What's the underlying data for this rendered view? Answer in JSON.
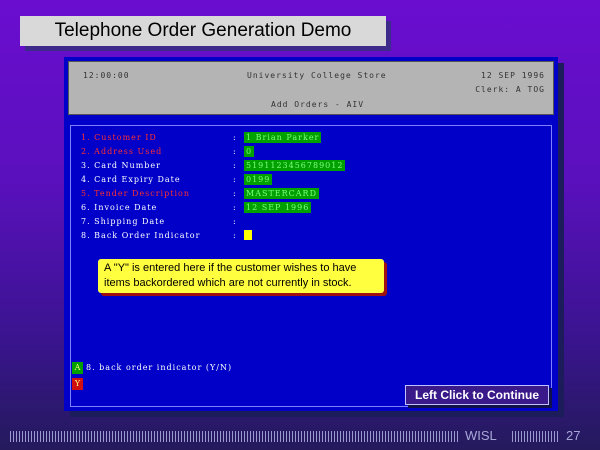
{
  "title": "Telephone Order Generation Demo",
  "header": {
    "time": "12:00:00",
    "store": "University College Store",
    "date": "12 SEP 1996",
    "clerk": "Clerk: A TOG",
    "mode": "Add Orders - AIV"
  },
  "fields": [
    {
      "label": "1. Customer ID",
      "value": "1 Brian Parker",
      "color": "#ff3030"
    },
    {
      "label": "2. Address Used",
      "value": "0",
      "color": "#ff3030"
    },
    {
      "label": "3. Card Number",
      "value": "5191123456789012",
      "color": "#ffffff"
    },
    {
      "label": "4. Card Expiry Date",
      "value": "0199",
      "color": "#ffffff"
    },
    {
      "label": "5. Tender Description",
      "value": "MASTERCARD",
      "color": "#ff3030"
    },
    {
      "label": "6. Invoice Date",
      "value": "12 SEP 1996",
      "color": "#ffffff"
    },
    {
      "label": "7. Shipping Date",
      "value": "",
      "color": "#ffffff"
    },
    {
      "label": "8. Back Order Indicator",
      "value": "",
      "color": "#ffffff"
    }
  ],
  "colon": ":",
  "callout": {
    "line1": "A \"Y\" is entered here if the customer wishes to have",
    "line2": "items backordered which are not currently in stock."
  },
  "hint": {
    "badge": "A",
    "text": "8. back order indicator (Y/N)"
  },
  "entry": {
    "value": "Y"
  },
  "continue_label": "Left Click to Continue",
  "footer": {
    "org": "WISL",
    "page": "27"
  }
}
